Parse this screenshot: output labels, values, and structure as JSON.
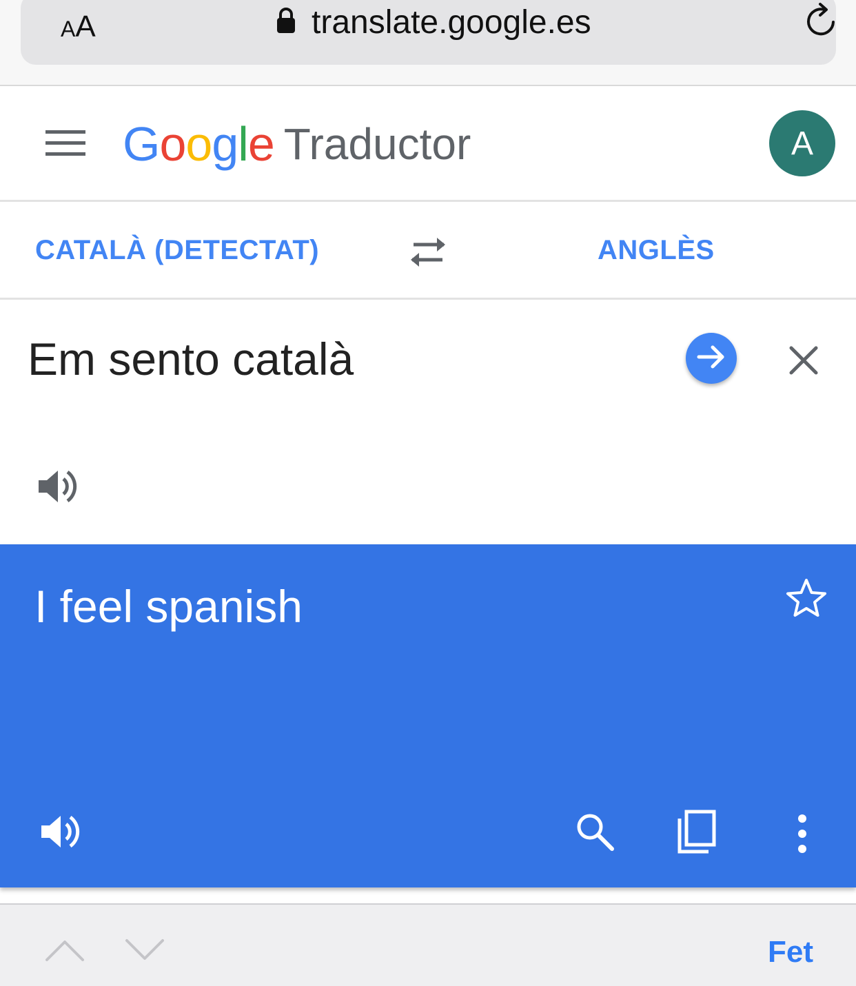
{
  "browser": {
    "text_size_small": "A",
    "text_size_large": "A",
    "url": "translate.google.es",
    "lock_icon": "lock-icon",
    "reload_icon": "reload-icon"
  },
  "header": {
    "logo_google_letters": [
      "G",
      "o",
      "o",
      "g",
      "l",
      "e"
    ],
    "product_name": "Traductor",
    "avatar_initial": "A",
    "avatar_color": "#2b7a72",
    "menu_icon": "hamburger-menu-icon"
  },
  "languages": {
    "source": "CATALÀ (DETECTAT)",
    "target": "ANGLÈS",
    "swap_icon": "swap-arrows-icon"
  },
  "input": {
    "text": "Em sento català",
    "go_icon": "arrow-right-icon",
    "clear_icon": "close-icon",
    "speak_icon": "speaker-icon"
  },
  "result": {
    "text": "I feel spanish",
    "background_color": "#3474e4",
    "star_icon": "star-outline-icon",
    "speak_icon": "speaker-icon",
    "search_icon": "search-icon",
    "copy_icon": "copy-icon",
    "more_icon": "more-vertical-icon"
  },
  "accessory": {
    "prev_icon": "chevron-up-icon",
    "next_icon": "chevron-down-icon",
    "done_label": "Fet"
  },
  "colors": {
    "accent": "#4285f4",
    "done_blue": "#2f7bf5"
  }
}
